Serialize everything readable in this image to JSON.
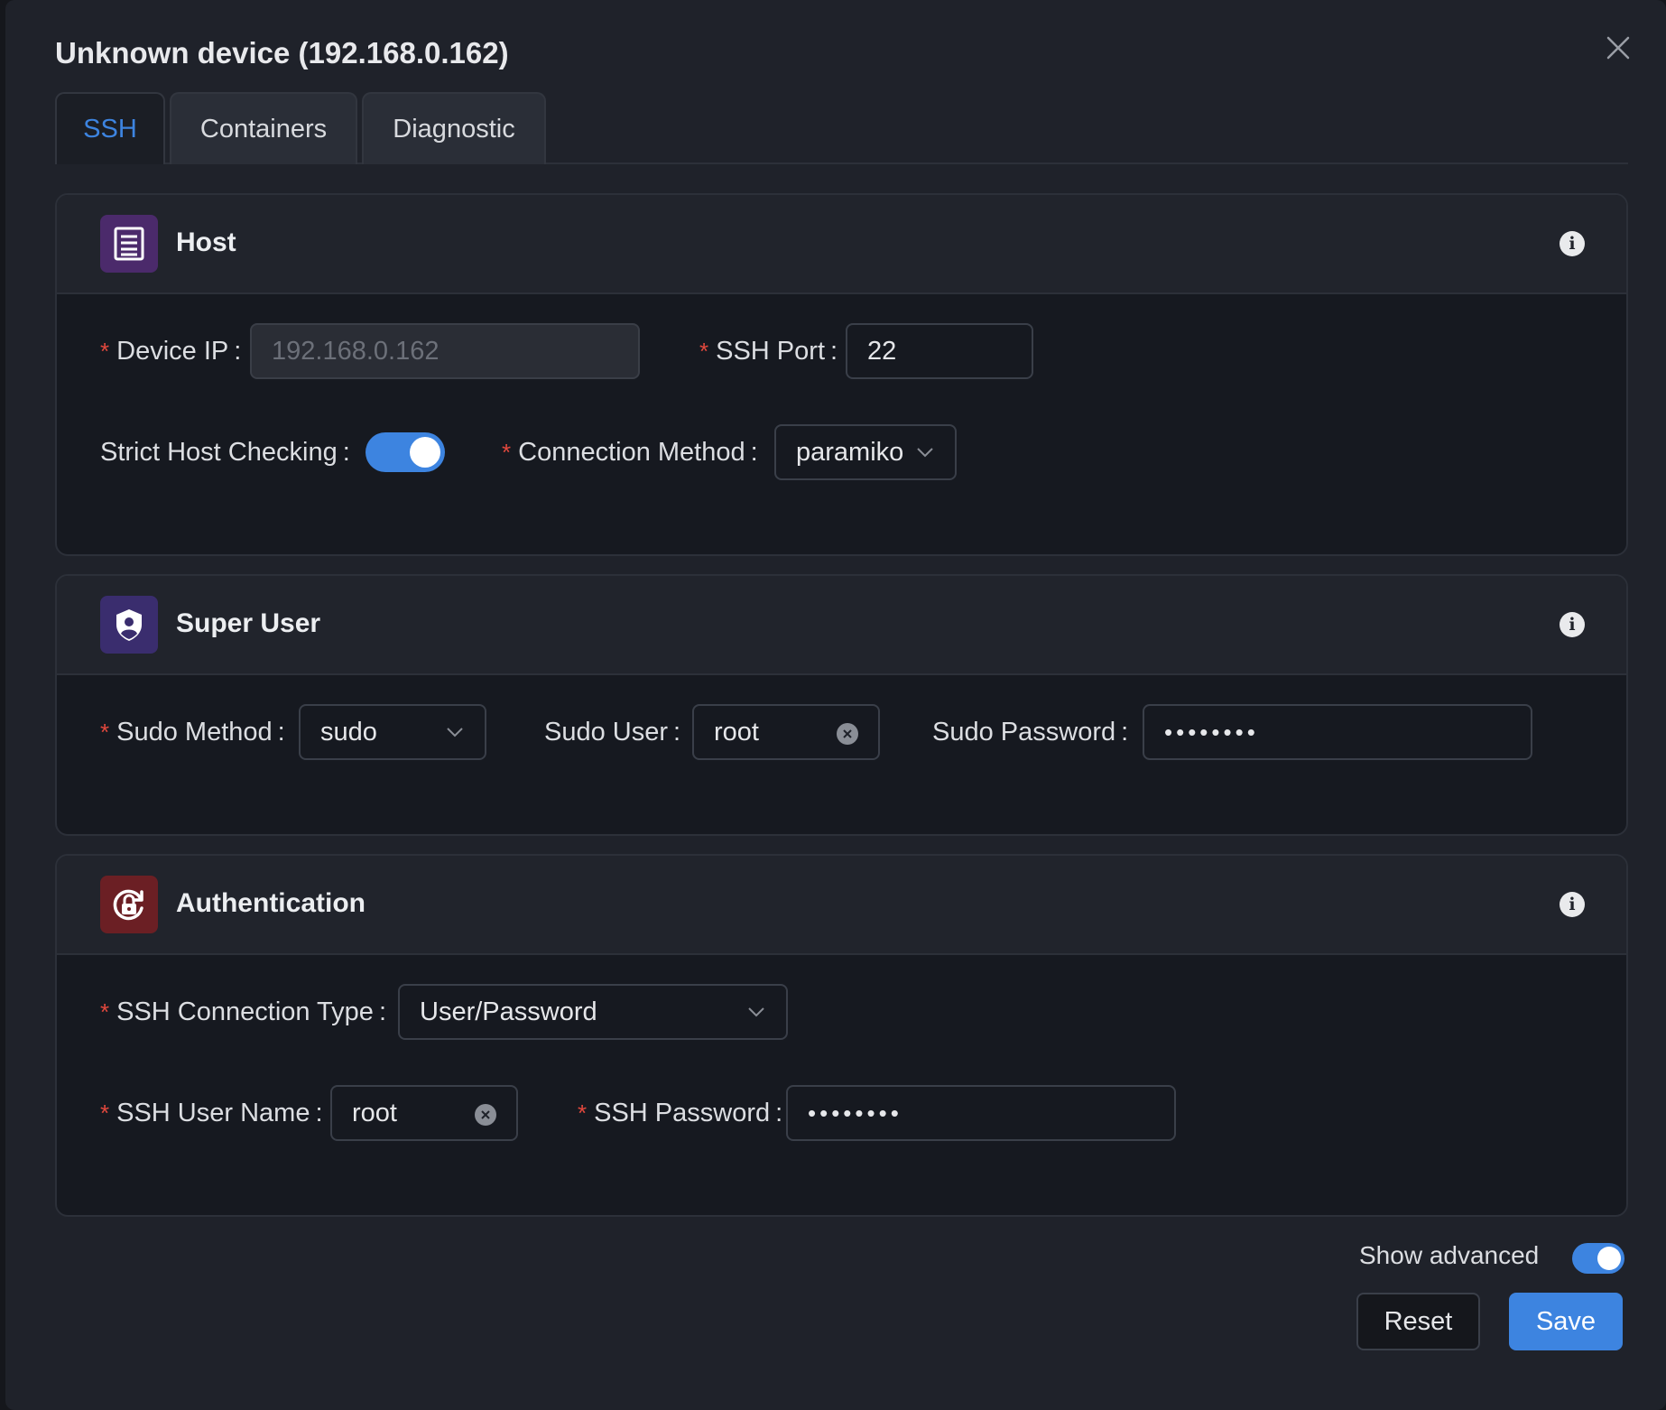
{
  "dialog": {
    "title": "Unknown device (192.168.0.162)"
  },
  "tabs": [
    {
      "label": "SSH",
      "active": true
    },
    {
      "label": "Containers",
      "active": false
    },
    {
      "label": "Diagnostic",
      "active": false
    }
  ],
  "host": {
    "title": "Host",
    "icon": "server-icon",
    "device_ip": {
      "label": "Device IP",
      "placeholder": "192.168.0.162",
      "value": ""
    },
    "ssh_port": {
      "label": "SSH Port",
      "value": "22"
    },
    "strict_host_checking": {
      "label": "Strict Host Checking",
      "enabled": true
    },
    "connection_method": {
      "label": "Connection Method",
      "value": "paramiko"
    }
  },
  "super_user": {
    "title": "Super User",
    "icon": "shield-user-icon",
    "sudo_method": {
      "label": "Sudo Method",
      "value": "sudo"
    },
    "sudo_user": {
      "label": "Sudo User",
      "value": "root"
    },
    "sudo_password": {
      "label": "Sudo Password",
      "value": "••••••••"
    }
  },
  "authentication": {
    "title": "Authentication",
    "icon": "lock-refresh-icon",
    "connection_type": {
      "label": "SSH Connection Type",
      "value": "User/Password"
    },
    "user_name": {
      "label": "SSH User Name",
      "value": "root"
    },
    "password": {
      "label": "SSH Password",
      "value": "••••••••"
    }
  },
  "footer": {
    "show_advanced": {
      "label": "Show advanced",
      "enabled": true
    },
    "reset_label": "Reset",
    "save_label": "Save"
  },
  "colors": {
    "accent": "#3d84e0",
    "required": "#e2483d",
    "host_icon_bg": "#4b2a6b",
    "super_user_icon_bg": "#3a2d6e",
    "auth_icon_bg": "#6b1f24"
  }
}
